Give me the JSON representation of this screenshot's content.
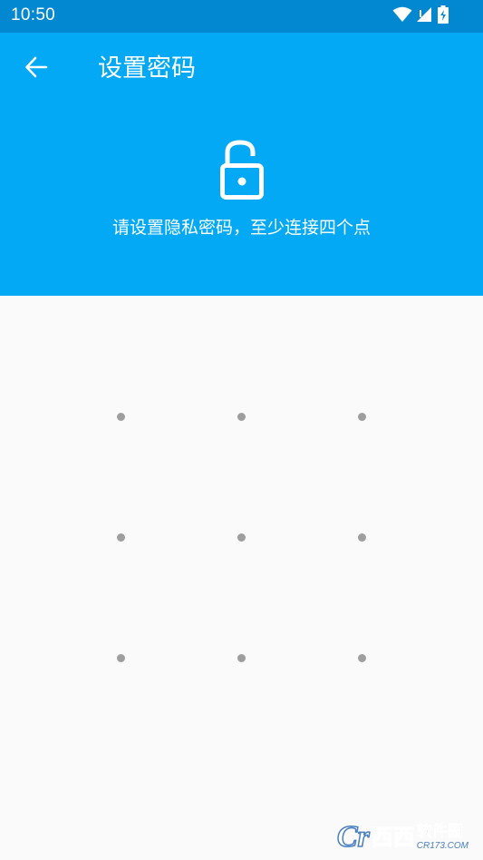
{
  "status_bar": {
    "time": "10:50",
    "icons": [
      "wifi-icon",
      "signal-icon",
      "battery-charging-icon"
    ]
  },
  "header": {
    "title": "设置密码",
    "hint": "请设置隐私密码，至少连接四个点",
    "icons": {
      "back": "arrow-left-icon",
      "lock": "lock-open-icon"
    }
  },
  "pattern": {
    "rows": 3,
    "cols": 3
  },
  "watermark": {
    "logo": "Cr",
    "brand": "西西",
    "name": "软件园",
    "url": "CR173.COM"
  },
  "colors": {
    "primary": "#03a9f4",
    "primary_dark": "#0288d1",
    "background": "#fafafa",
    "dot": "#9e9e9e"
  }
}
